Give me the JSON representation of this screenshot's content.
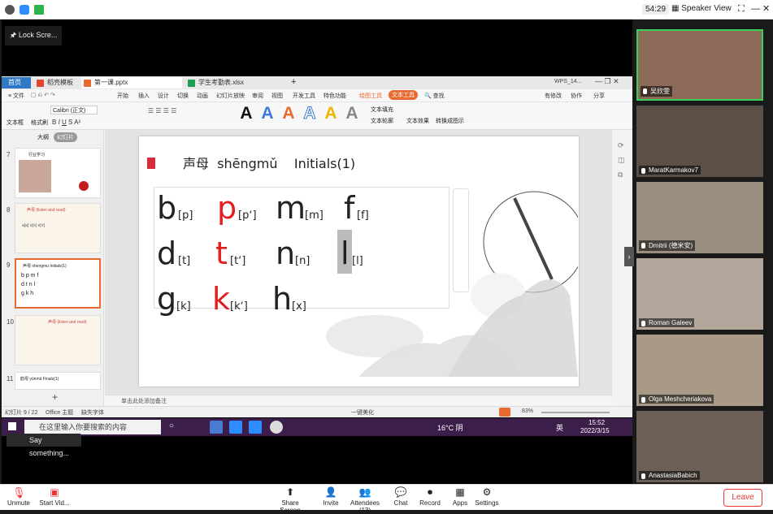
{
  "zoom_top": {
    "timer": "54:29",
    "view": "Speaker View"
  },
  "lock_screen": "Lock Scre...",
  "wps": {
    "tabs": [
      {
        "label": "首页",
        "color": "#3178c6"
      },
      {
        "label": "稻壳模板",
        "color": "#e2452b"
      },
      {
        "label": "第一课.pptx",
        "color": "#e96a2f"
      },
      {
        "label": "学生考勤表.xlsx",
        "color": "#1e9e55"
      }
    ],
    "wps_account": "WPS_14...",
    "menu": [
      "文件",
      "开始",
      "插入",
      "设计",
      "切换",
      "动画",
      "幻灯片放映",
      "审阅",
      "视图",
      "开发工具",
      "特色功能",
      "绘图工具",
      "文本工具"
    ],
    "search_label": "查找",
    "right_menu": [
      "有修改",
      "协作",
      "分享"
    ],
    "font_name": "Calibri (正文)",
    "left_ribbon": [
      "文本框",
      "格式刷"
    ],
    "right_ribbon": [
      "文本填充",
      "文本轮廓",
      "文本效果",
      "转换成图示"
    ],
    "panel_tabs": [
      "大纲",
      "幻灯片"
    ],
    "thumbs": [
      {
        "num": "7",
        "title": "行业学习"
      },
      {
        "num": "8",
        "title": "声母 (listen and read)"
      },
      {
        "num": "9",
        "title": "声母 shengmu Initials(1)"
      },
      {
        "num": "10",
        "title": "声母 (listen and read)"
      },
      {
        "num": "11",
        "title": "韵母 yùnmǔ Finals(1)"
      }
    ],
    "notes": "单击此处添加备注",
    "status": {
      "slide": "幻灯片 9 / 22",
      "theme": "Office 主题",
      "font": "缺失字体",
      "beautify": "一键美化",
      "zoom": "83%"
    }
  },
  "slide": {
    "title_cn": "声母",
    "title_py": "shēngmǔ",
    "title_en": "Initials(1)",
    "rows": [
      [
        {
          "l": "b",
          "ipa": "[p]",
          "red": false
        },
        {
          "l": "p",
          "ipa": "[pʻ]",
          "red": true
        },
        {
          "l": "m",
          "ipa": "[m]",
          "red": false
        },
        {
          "l": "f",
          "ipa": "[f]",
          "red": false
        }
      ],
      [
        {
          "l": "d",
          "ipa": "[t]",
          "red": false
        },
        {
          "l": "t",
          "ipa": "[tʻ]",
          "red": true
        },
        {
          "l": "n",
          "ipa": "[n]",
          "red": false
        },
        {
          "l": "l",
          "ipa": "[l]",
          "red": false
        }
      ],
      [
        {
          "l": "g",
          "ipa": "[k]",
          "red": false
        },
        {
          "l": "k",
          "ipa": "[kʻ]",
          "red": true
        },
        {
          "l": "h",
          "ipa": "[x]",
          "red": false
        }
      ]
    ]
  },
  "taskbar": {
    "search": "在这里输入你要搜索的内容",
    "weather": "16°C 阴",
    "ime": "英",
    "time": "15:52",
    "date": "2022/3/15"
  },
  "say": "Say something...",
  "participants": [
    {
      "name": "吴欣雯",
      "bg": "#8c6a58"
    },
    {
      "name": "MaratKarmakov7",
      "bg": "#5a5048"
    },
    {
      "name": "Dmitrii (德米安)",
      "bg": "#9a8e80"
    },
    {
      "name": "Roman Galeev",
      "bg": "#b3a79b"
    },
    {
      "name": "Olga Meshcheriakova",
      "bg": "#a89a86"
    },
    {
      "name": "AnastasiaBabich",
      "bg": "#6b5f58"
    }
  ],
  "bottom": [
    "Unmute",
    "Start Vid...",
    "Share Screen",
    "Invite",
    "Attendees (13)",
    "Chat",
    "Record",
    "Apps",
    "Settings"
  ],
  "leave": "Leave"
}
